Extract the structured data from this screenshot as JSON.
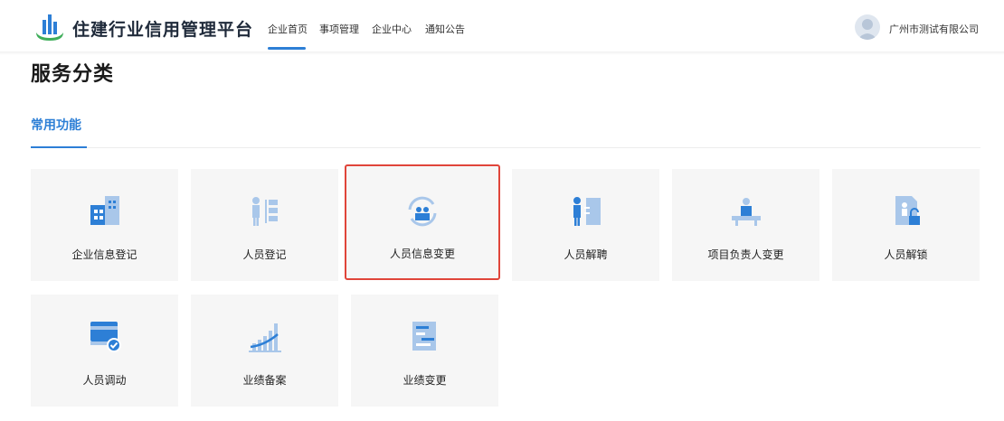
{
  "header": {
    "app_title": "住建行业信用管理平台",
    "nav": [
      {
        "label": "企业首页",
        "active": true
      },
      {
        "label": "事项管理",
        "active": false
      },
      {
        "label": "企业中心",
        "active": false
      },
      {
        "label": "通知公告",
        "active": false
      }
    ],
    "company_name": "广州市测试有限公司"
  },
  "page": {
    "title": "服务分类",
    "section_tab": "常用功能"
  },
  "services": [
    {
      "label": "企业信息登记",
      "icon": "building-icon",
      "selected": false
    },
    {
      "label": "人员登记",
      "icon": "person-register-icon",
      "selected": false
    },
    {
      "label": "人员信息变更",
      "icon": "person-change-icon",
      "selected": true
    },
    {
      "label": "人员解聘",
      "icon": "person-dismiss-icon",
      "selected": false
    },
    {
      "label": "项目负责人变更",
      "icon": "project-leader-icon",
      "selected": false
    },
    {
      "label": "人员解锁",
      "icon": "person-unlock-icon",
      "selected": false
    },
    {
      "label": "人员调动",
      "icon": "person-transfer-icon",
      "selected": false
    },
    {
      "label": "业绩备案",
      "icon": "performance-record-icon",
      "selected": false
    },
    {
      "label": "业绩变更",
      "icon": "performance-change-icon",
      "selected": false
    }
  ],
  "colors": {
    "accent": "#2d7fd6",
    "highlight_border": "#e0453a",
    "card_bg": "#f6f6f6"
  }
}
